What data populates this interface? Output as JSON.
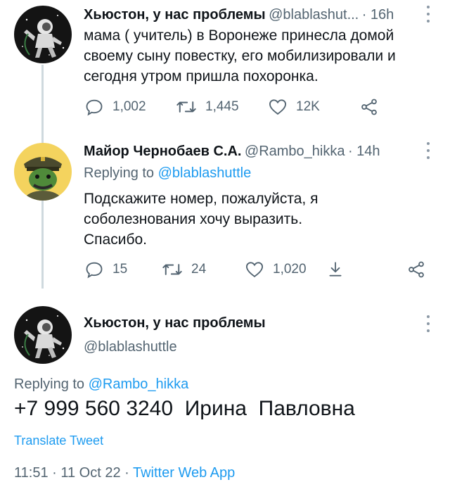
{
  "tweet1": {
    "name": "Хьюстон, у нас проблемы",
    "handle": "@blablashut...",
    "time": "· 16h",
    "text_lines": [
      "мама ( учитель) в Воронеже принесла домой",
      "своему сыну повестку, его  мобилизировали и",
      "сегодня утром пришла похоронка."
    ],
    "replies": "1,002",
    "retweets": "1,445",
    "likes": "12K"
  },
  "tweet2": {
    "name": "Майор Чернобаев С.А.",
    "handle": "@Rambo_hikka",
    "time": "· 14h",
    "replying_prefix": "Replying to",
    "replying_handle": "@blablashuttle",
    "text_lines": [
      "Подскажите номер, пожалуйста, я",
      "соболезнования хочу выразить.",
      "Спасибо."
    ],
    "replies": "15",
    "retweets": "24",
    "likes": "1,020"
  },
  "tweet3": {
    "name": "Хьюстон, у нас проблемы",
    "handle": "@blablashuttle",
    "replying_prefix": "Replying to",
    "replying_handle": "@Rambo_hikka",
    "text": "+7 999 560 3240  Ирина  Павловна",
    "translate": "Translate Tweet",
    "timestamp": "11:51 · 11 Oct 22 ·",
    "source": "Twitter Web App"
  },
  "colors": {
    "accent": "#1d9bf0",
    "secondary_text": "#536471",
    "thread_line": "#cfd9de"
  },
  "icons": [
    "reply-icon",
    "retweet-icon",
    "like-icon",
    "share-icon",
    "upload-icon",
    "more-icon"
  ]
}
